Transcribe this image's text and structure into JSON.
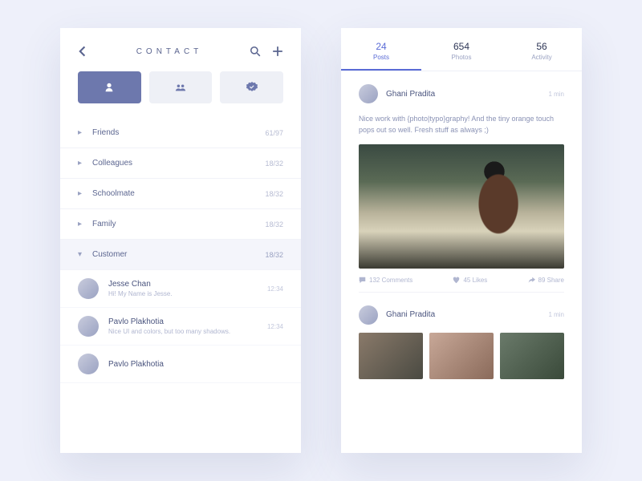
{
  "left": {
    "title": "CONTACT",
    "groups": [
      {
        "name": "Friends",
        "count": "61/97"
      },
      {
        "name": "Colleagues",
        "count": "18/32"
      },
      {
        "name": "Schoolmate",
        "count": "18/32"
      },
      {
        "name": "Family",
        "count": "18/32"
      },
      {
        "name": "Customer",
        "count": "18/32"
      }
    ],
    "contacts": [
      {
        "name": "Jesse Chan",
        "msg": "Hi! My Name is Jesse.",
        "time": "12:34"
      },
      {
        "name": "Pavlo Plakhotia",
        "msg": "Nice UI and colors, but too many shadows.",
        "time": "12:34"
      },
      {
        "name": "Pavlo Plakhotia",
        "msg": "",
        "time": ""
      }
    ]
  },
  "right": {
    "tabs": [
      {
        "num": "24",
        "lbl": "Posts"
      },
      {
        "num": "654",
        "lbl": "Photos"
      },
      {
        "num": "56",
        "lbl": "Activity"
      }
    ],
    "post1": {
      "author": "Ghani Pradita",
      "time": "1 min",
      "body": "Nice work with {photo|typo}graphy! And the tiny orange touch pops out so well. Fresh stuff as always ;)",
      "comments": "132 Comments",
      "likes": "45 Likes",
      "shares": "89 Share"
    },
    "post2": {
      "author": "Ghani Pradita",
      "time": "1 min"
    }
  }
}
